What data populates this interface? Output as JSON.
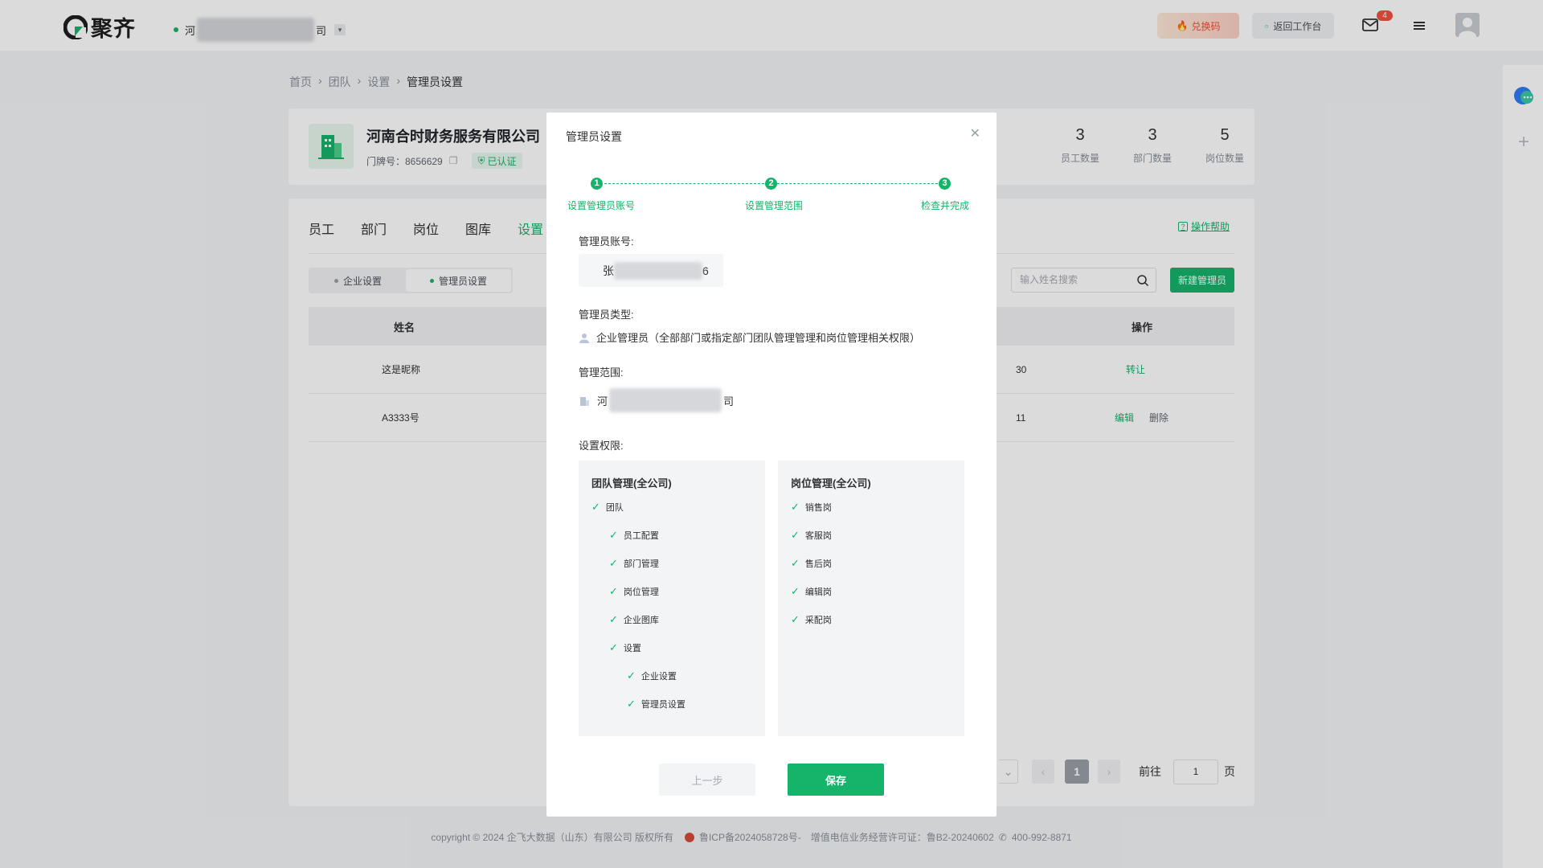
{
  "header": {
    "brand": "聚齐",
    "company_prefix": "河",
    "company_suffix": "司",
    "redeem_label": "兑换码",
    "back_label": "返回工作台",
    "mail_badge": "4"
  },
  "breadcrumb": [
    "首页",
    "团队",
    "设置",
    "管理员设置"
  ],
  "company": {
    "name": "河南合时财务服务有限公司",
    "door_label": "门牌号：8656629",
    "verified_label": "已认证",
    "stats": [
      {
        "value": "3",
        "label": "员工数量"
      },
      {
        "value": "3",
        "label": "部门数量"
      },
      {
        "value": "5",
        "label": "岗位数量"
      }
    ]
  },
  "tabs": [
    "员工",
    "部门",
    "岗位",
    "图库",
    "设置"
  ],
  "help_label": "操作帮助",
  "segments": [
    "企业设置",
    "管理员设置"
  ],
  "search_placeholder": "输入姓名搜索",
  "new_admin_label": "新建管理员",
  "table": {
    "col_name": "姓名",
    "col_action": "操作",
    "rows": [
      {
        "name": "这是昵称",
        "partial": "30",
        "actions": [
          "转让"
        ]
      },
      {
        "name": "A3333号",
        "partial": "11",
        "actions": [
          "编辑",
          "删除"
        ]
      }
    ]
  },
  "pagination": {
    "current": "1",
    "goto_label": "前往",
    "goto_value": "1",
    "page_unit": "页"
  },
  "footer": {
    "copyright": "copyright © 2024 企飞大数据（山东）有限公司 版权所有",
    "icp": "鲁ICP备2024058728号-",
    "license": "增值电信业务经营许可证：鲁B2-20240602",
    "phone": "400-992-8871"
  },
  "modal": {
    "title": "管理员设置",
    "steps": [
      {
        "num": "1",
        "label": "设置管理员账号"
      },
      {
        "num": "2",
        "label": "设置管理范围"
      },
      {
        "num": "3",
        "label": "检查并完成"
      }
    ],
    "account_label": "管理员账号:",
    "account_prefix": "张",
    "account_suffix": "6",
    "type_label": "管理员类型:",
    "type_value": "企业管理员（全部部门或指定部门团队管理管理和岗位管理相关权限）",
    "scope_label": "管理范围:",
    "scope_prefix": "河",
    "scope_suffix": "司",
    "perm_label": "设置权限:",
    "team_panel": {
      "title": "团队管理(全公司)",
      "items": [
        "团队",
        "员工配置",
        "部门管理",
        "岗位管理",
        "企业图库",
        "设置",
        "企业设置",
        "管理员设置"
      ]
    },
    "post_panel": {
      "title": "岗位管理(全公司)",
      "items": [
        "销售岗",
        "客服岗",
        "售后岗",
        "编辑岗",
        "采配岗"
      ]
    },
    "prev_label": "上一步",
    "save_label": "保存"
  }
}
